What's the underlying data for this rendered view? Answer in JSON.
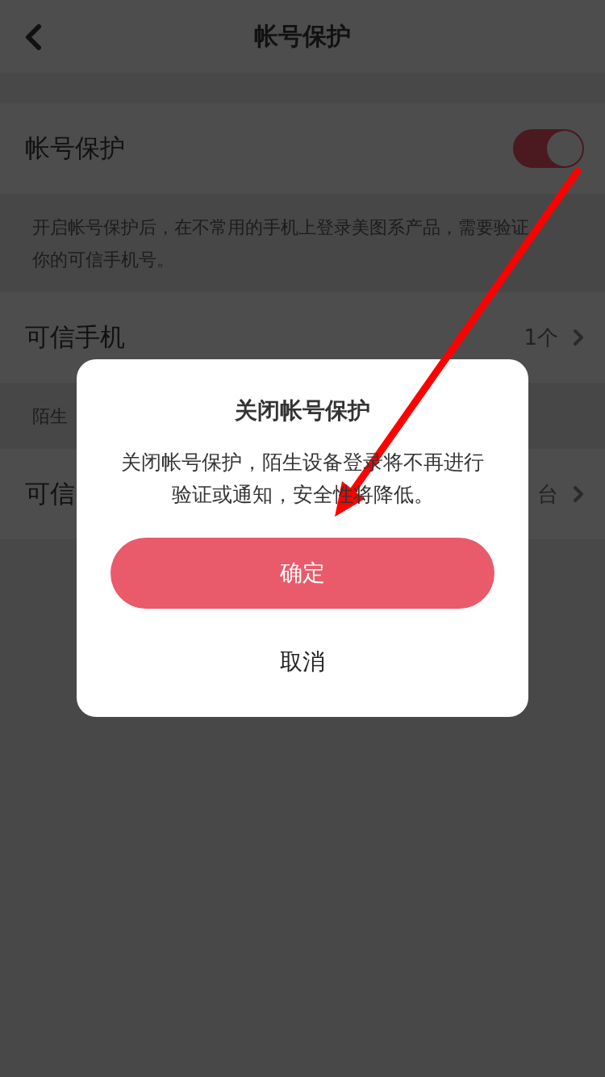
{
  "header": {
    "title": "帐号保护"
  },
  "settings": [
    {
      "kind": "toggle",
      "label": "帐号保护",
      "on": true
    },
    {
      "kind": "note",
      "text": "开启帐号保护后，在不常用的手机上登录美图系产品，需要验证你的可信手机号。"
    },
    {
      "kind": "link",
      "label": "可信手机",
      "value": "1个"
    },
    {
      "kind": "note",
      "text": "陌生"
    },
    {
      "kind": "link",
      "label": "可信",
      "value": "台"
    }
  ],
  "dialog": {
    "title": "关闭帐号保护",
    "message": "关闭帐号保护，陌生设备登录将不再进行验证或通知，安全性将降低。",
    "confirm": "确定",
    "cancel": "取消"
  }
}
